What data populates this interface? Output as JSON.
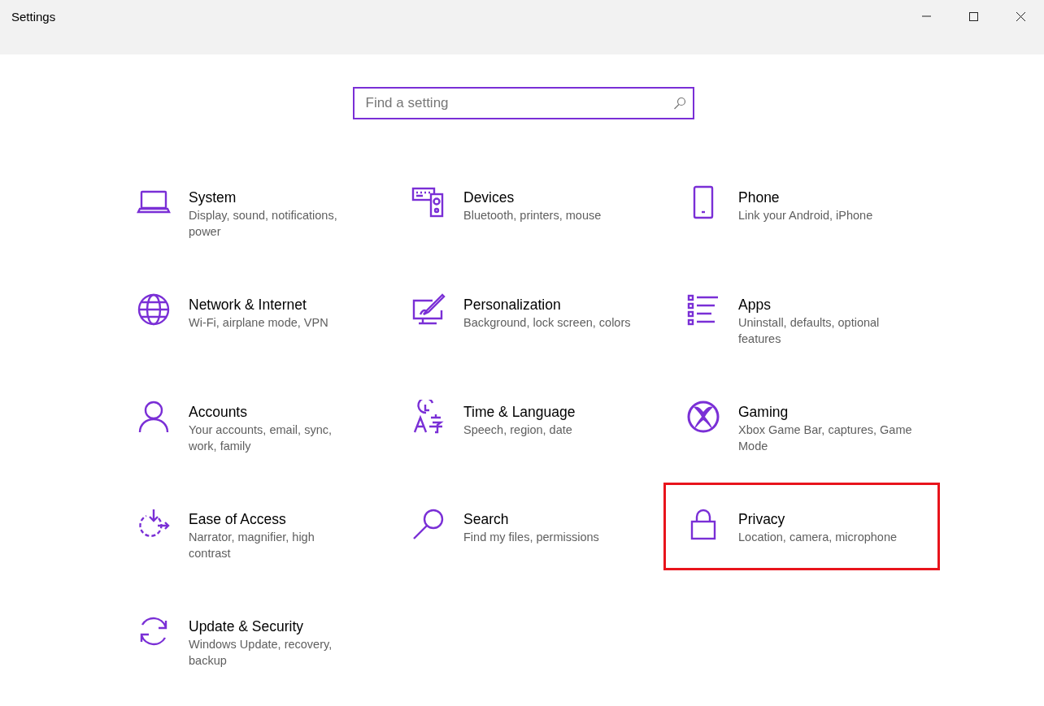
{
  "window": {
    "title": "Settings"
  },
  "search": {
    "placeholder": "Find a setting"
  },
  "items": [
    {
      "title": "System",
      "description": "Display, sound, notifications, power",
      "highlighted": false
    },
    {
      "title": "Devices",
      "description": "Bluetooth, printers, mouse",
      "highlighted": false
    },
    {
      "title": "Phone",
      "description": "Link your Android, iPhone",
      "highlighted": false
    },
    {
      "title": "Network & Internet",
      "description": "Wi-Fi, airplane mode, VPN",
      "highlighted": false
    },
    {
      "title": "Personalization",
      "description": "Background, lock screen, colors",
      "highlighted": false
    },
    {
      "title": "Apps",
      "description": "Uninstall, defaults, optional features",
      "highlighted": false
    },
    {
      "title": "Accounts",
      "description": "Your accounts, email, sync, work, family",
      "highlighted": false
    },
    {
      "title": "Time & Language",
      "description": "Speech, region, date",
      "highlighted": false
    },
    {
      "title": "Gaming",
      "description": "Xbox Game Bar, captures, Game Mode",
      "highlighted": false
    },
    {
      "title": "Ease of Access",
      "description": "Narrator, magnifier, high contrast",
      "highlighted": false
    },
    {
      "title": "Search",
      "description": "Find my files, permissions",
      "highlighted": false
    },
    {
      "title": "Privacy",
      "description": "Location, camera, microphone",
      "highlighted": true
    },
    {
      "title": "Update & Security",
      "description": "Windows Update, recovery, backup",
      "highlighted": false
    }
  ]
}
